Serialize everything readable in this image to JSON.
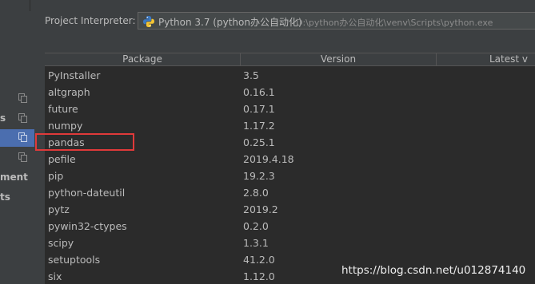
{
  "sidebar": {
    "labels": [
      {
        "text": "s"
      },
      {
        "text": "ment"
      },
      {
        "text": "ts"
      }
    ]
  },
  "interpreter": {
    "label": "Project Interpreter:",
    "name": "Python 3.7 (python办公自动化)",
    "path": "D:\\python办公自动化\\venv\\Scripts\\python.exe",
    "icon": "python-icon"
  },
  "table": {
    "headers": {
      "package": "Package",
      "version": "Version",
      "latest": "Latest v"
    },
    "rows": [
      {
        "package": "PyInstaller",
        "version": "3.5"
      },
      {
        "package": "altgraph",
        "version": "0.16.1"
      },
      {
        "package": "future",
        "version": "0.17.1"
      },
      {
        "package": "numpy",
        "version": "1.17.2"
      },
      {
        "package": "pandas",
        "version": "0.25.1"
      },
      {
        "package": "pefile",
        "version": "2019.4.18"
      },
      {
        "package": "pip",
        "version": "19.2.3"
      },
      {
        "package": "python-dateutil",
        "version": "2.8.0"
      },
      {
        "package": "pytz",
        "version": "2019.2"
      },
      {
        "package": "pywin32-ctypes",
        "version": "0.2.0"
      },
      {
        "package": "scipy",
        "version": "1.3.1"
      },
      {
        "package": "setuptools",
        "version": "41.2.0"
      },
      {
        "package": "six",
        "version": "1.12.0"
      }
    ]
  },
  "highlight_color": "#e03a3a",
  "selection_color": "#4b6eaf",
  "watermark": "https://blog.csdn.net/u012874140"
}
